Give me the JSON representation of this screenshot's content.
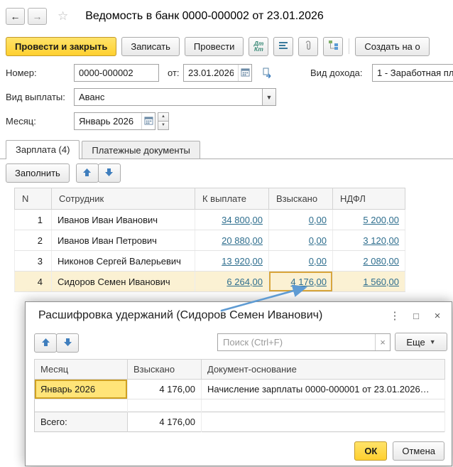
{
  "titlebar": {
    "title": "Ведомость в банк 0000-000002 от 23.01.2026"
  },
  "icons": {
    "back": "←",
    "forward": "→",
    "favorite": "☆",
    "dropdown": "▼",
    "spin_up": "▲",
    "spin_down": "▼",
    "clear": "×",
    "dialog_more": "⋮",
    "dialog_maximize": "□",
    "dialog_close": "×"
  },
  "toolbar": {
    "post_and_close": "Провести и закрыть",
    "save": "Записать",
    "post": "Провести",
    "dtkt_top": "Дт",
    "dtkt_bottom": "Кт",
    "create_based_on": "Создать на о"
  },
  "form": {
    "number": {
      "label": "Номер:",
      "value": "0000-000002"
    },
    "date": {
      "label": "от:",
      "value": "23.01.2026"
    },
    "income_type": {
      "label": "Вид дохода:",
      "value": "1 - Заработная пл"
    },
    "payment_type": {
      "label": "Вид выплаты:",
      "value": "Аванс"
    },
    "month": {
      "label": "Месяц:",
      "value": "Январь 2026"
    }
  },
  "tabs": {
    "salary": "Зарплата (4)",
    "payment_documents": "Платежные документы"
  },
  "table_toolbar": {
    "fill": "Заполнить"
  },
  "main_table": {
    "columns": {
      "n": "N",
      "employee": "Сотрудник",
      "payout": "К выплате",
      "withheld": "Взыскано",
      "ndfl": "НДФЛ"
    },
    "rows": [
      {
        "n": "1",
        "employee": "Иванов Иван Иванович",
        "payout": "34 800,00",
        "withheld": "0,00",
        "ndfl": "5 200,00"
      },
      {
        "n": "2",
        "employee": "Иванов Иван Петрович",
        "payout": "20 880,00",
        "withheld": "0,00",
        "ndfl": "3 120,00"
      },
      {
        "n": "3",
        "employee": "Никонов Сергей Валерьевич",
        "payout": "13 920,00",
        "withheld": "0,00",
        "ndfl": "2 080,00"
      },
      {
        "n": "4",
        "employee": "Сидоров Семен Иванович",
        "payout": "6 264,00",
        "withheld": "4 176,00",
        "ndfl": "1 560,00"
      }
    ]
  },
  "dialog": {
    "title": "Расшифровка удержаний (Сидоров Семен Иванович)",
    "search_placeholder": "Поиск (Ctrl+F)",
    "more": "Еще",
    "table": {
      "columns": {
        "month": "Месяц",
        "withheld": "Взыскано",
        "document": "Документ-основание"
      },
      "rows": [
        {
          "month": "Январь 2026",
          "withheld": "4 176,00",
          "document": "Начисление зарплаты 0000-000001 от 23.01.2026…"
        }
      ],
      "total_label": "Всего:",
      "total_value": "4 176,00"
    },
    "ok": "ОК",
    "cancel": "Отмена"
  },
  "colors": {
    "accent_yellow": "#ffd335",
    "table_link": "#2e6e8e",
    "selection_fill": "#fbf1d3",
    "selection_border": "#d9a63c",
    "dialog_cell_fill": "#ffe478",
    "callout_arrow": "#5e9bd3"
  }
}
